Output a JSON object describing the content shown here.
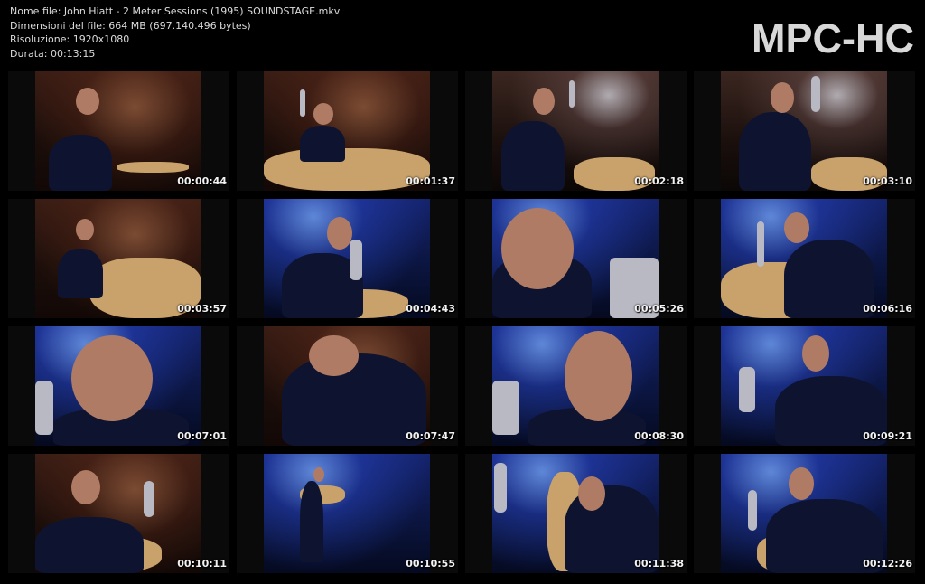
{
  "info": {
    "filename": "Nome file: John Hiatt - 2 Meter Sessions (1995) SOUNDSTAGE.mkv",
    "filesize": "Dimensioni del file: 664 MB (697.140.496 bytes)",
    "resolution": "Risoluzione: 1920x1080",
    "duration": "Durata: 00:13:15"
  },
  "logo": "MPC-HC",
  "thumbnails": [
    {
      "time": "00:00:44",
      "tone": "warm"
    },
    {
      "time": "00:01:37",
      "tone": "warm"
    },
    {
      "time": "00:02:18",
      "tone": "mixed"
    },
    {
      "time": "00:03:10",
      "tone": "mixed"
    },
    {
      "time": "00:03:57",
      "tone": "warm"
    },
    {
      "time": "00:04:43",
      "tone": "blue"
    },
    {
      "time": "00:05:26",
      "tone": "blue"
    },
    {
      "time": "00:06:16",
      "tone": "blue"
    },
    {
      "time": "00:07:01",
      "tone": "blue"
    },
    {
      "time": "00:07:47",
      "tone": "warm"
    },
    {
      "time": "00:08:30",
      "tone": "blue"
    },
    {
      "time": "00:09:21",
      "tone": "blue"
    },
    {
      "time": "00:10:11",
      "tone": "warm"
    },
    {
      "time": "00:10:55",
      "tone": "blue"
    },
    {
      "time": "00:11:38",
      "tone": "blue"
    },
    {
      "time": "00:12:26",
      "tone": "blue"
    }
  ]
}
